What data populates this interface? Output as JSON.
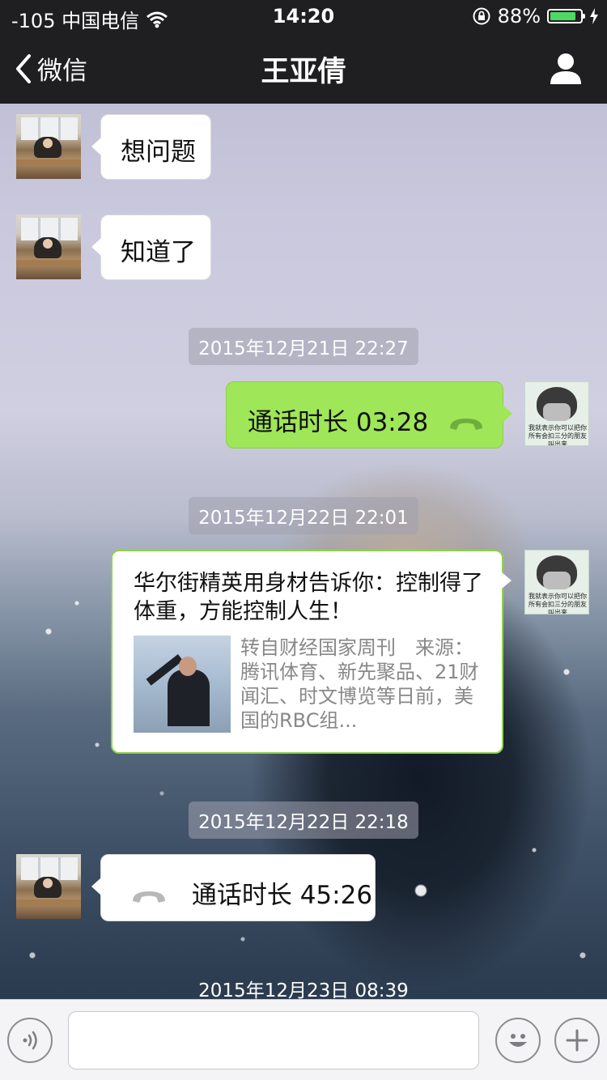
{
  "status_bar": {
    "carrier": "-105 中国电信",
    "time": "14:20",
    "battery_percent": "88%",
    "battery_level": 0.88
  },
  "nav": {
    "back_label": "微信",
    "title": "王亚倩"
  },
  "messages": [
    {
      "side": "left",
      "type": "text",
      "text": "想问题"
    },
    {
      "side": "left",
      "type": "text",
      "text": "知道了"
    },
    {
      "type": "timestamp",
      "text": "2015年12月21日 22:27"
    },
    {
      "side": "right",
      "type": "call",
      "text": "通话时长 03:28"
    },
    {
      "type": "timestamp",
      "text": "2015年12月22日 22:01"
    },
    {
      "side": "right",
      "type": "article",
      "title": "华尔街精英用身材告诉你：控制得了体重，方能控制人生！",
      "desc": "转自财经国家周刊　来源：腾讯体育、新先聚品、21财闻汇、时文博览等日前，美国的RBC组..."
    },
    {
      "type": "timestamp",
      "text": "2015年12月22日 22:18"
    },
    {
      "side": "left",
      "type": "call",
      "text": "通话时长 45:26"
    },
    {
      "type": "timestamp",
      "text": "2015年12月23日 08:39"
    }
  ],
  "avatar_meme_caption": "我就表示你可以把你所有会扣三分的朋友叫出来",
  "colors": {
    "sent_bubble": "#9fe658",
    "received_bubble": "#ffffff",
    "nav_bg": "#1f1f21",
    "battery_fill": "#4cd964"
  }
}
